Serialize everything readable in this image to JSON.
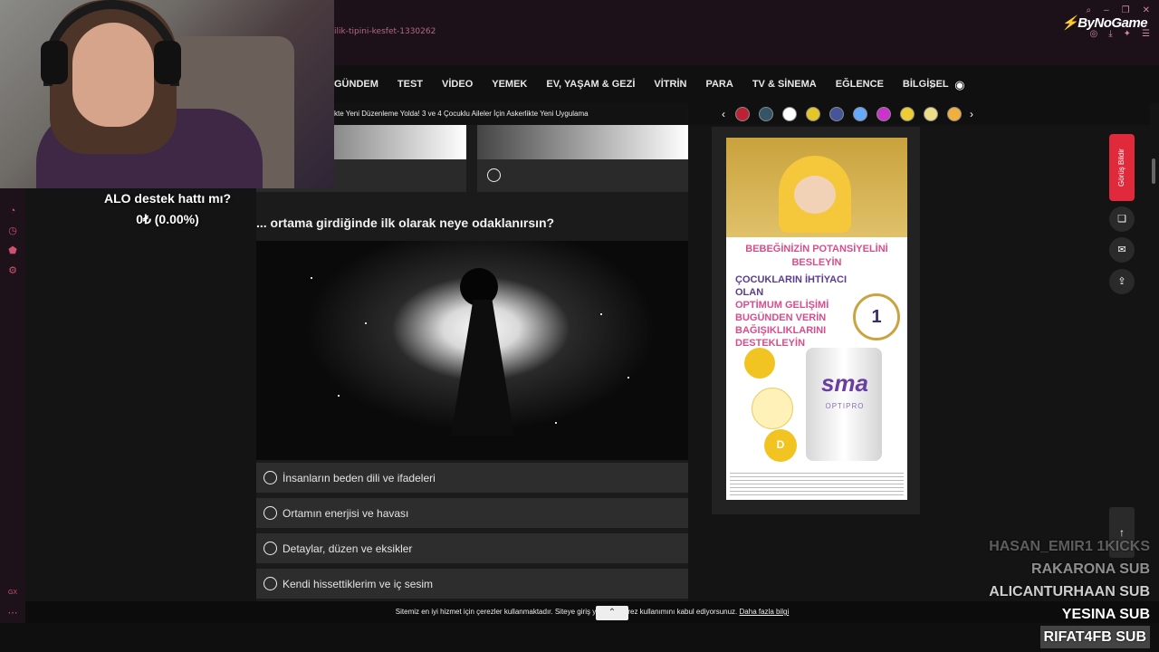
{
  "browser": {
    "url": "ilik-tipini-kesfet-1330262",
    "brand": "ByNoGame",
    "brand_prefix": "⚡"
  },
  "stream": {
    "donate_line1": "ALO destek hattı mı?",
    "donate_line2": "0₺ (0.00%)",
    "subs": [
      {
        "text": "HASAN_EMIR1 1KICKS"
      },
      {
        "text": "RAKARONA SUB"
      },
      {
        "text": "ALICANTURHAAN SUB"
      },
      {
        "text": "YESINA SUB"
      },
      {
        "text": "RIFAT4FB SUB"
      }
    ]
  },
  "nav": {
    "items": [
      "GÜNDEM",
      "TEST",
      "VİDEO",
      "YEMEK",
      "EV, YAŞAM & GEZİ",
      "VİTRİN",
      "PARA",
      "TV & SİNEMA",
      "EĞLENCE",
      "BİLGİSEL"
    ]
  },
  "ticker": {
    "text": "kte Yeni Düzenleme Yolda! 3 ve 4 Çocuklu Aileler İçin Askerlikte Yeni Uygulama"
  },
  "quiz": {
    "question": "... ortama girdiğinde ilk olarak neye odaklanırsın?",
    "options": [
      {
        "label": "İnsanların beden dili ve ifadeleri"
      },
      {
        "label": "Ortamın enerjisi ve havası"
      },
      {
        "label": "Detaylar, düzen ve eksikler"
      },
      {
        "label": "Kendi hissettiklerim ve iç sesim"
      }
    ]
  },
  "ad": {
    "headline": "BEBEĞİNİZİN POTANSİYELİNİ BESLEYİN",
    "body_a": "ÇOCUKLARIN İHTİYACI OLAN",
    "body_b": "OPTİMUM GELİŞİMİ BUGÜNDEN VERİN",
    "body_c": "BAĞIŞIKLIKLARINI",
    "body_d": "DESTEKLEYİN",
    "badge_number": "1",
    "product_logo": "sma",
    "product_name": "OPTIPRO",
    "vitamin": "D"
  },
  "side_buttons": {
    "feedback_label": "Görüş Bildir"
  },
  "cookie": {
    "text": "Sitemiz en iyi hizmet için çerezler kullanmaktadır. Siteye giriş yaparak çerez kullanımını kabul ediyorsunuz.",
    "link": "Daha fazla bilgi"
  },
  "colors": {
    "accent_red": "#e02a3b",
    "nav_bg": "#101010",
    "ad_pink": "#d84e8c",
    "ad_purple": "#5b3c8f"
  }
}
